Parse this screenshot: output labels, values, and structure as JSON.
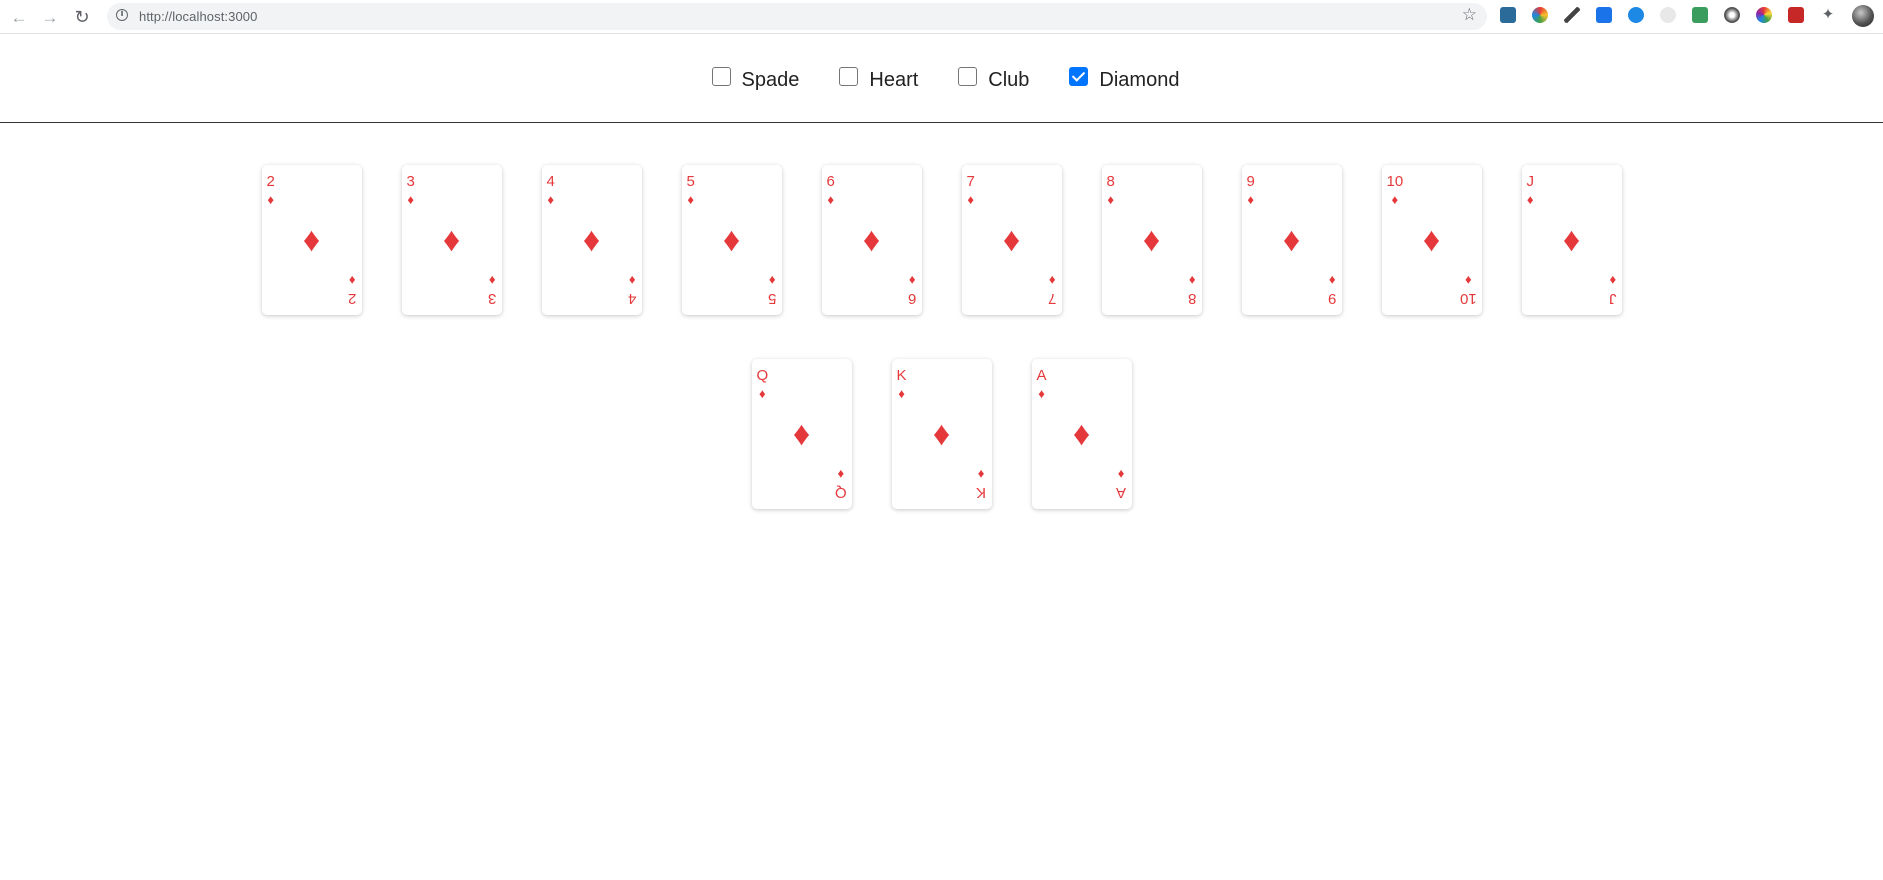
{
  "browser": {
    "url": "http://localhost:3000",
    "back_icon": "back-arrow-icon",
    "forward_icon": "forward-arrow-icon",
    "reload_icon": "reload-icon"
  },
  "filters": [
    {
      "label": "Spade",
      "checked": false
    },
    {
      "label": "Heart",
      "checked": false
    },
    {
      "label": "Club",
      "checked": false
    },
    {
      "label": "Diamond",
      "checked": true
    }
  ],
  "colors": {
    "card_red": "#e5383b",
    "checkbox_checked": "#0075ff"
  },
  "suit_symbol": "♦",
  "cards": [
    {
      "rank": "2",
      "suit": "diamond"
    },
    {
      "rank": "3",
      "suit": "diamond"
    },
    {
      "rank": "4",
      "suit": "diamond"
    },
    {
      "rank": "5",
      "suit": "diamond"
    },
    {
      "rank": "6",
      "suit": "diamond"
    },
    {
      "rank": "7",
      "suit": "diamond"
    },
    {
      "rank": "8",
      "suit": "diamond"
    },
    {
      "rank": "9",
      "suit": "diamond"
    },
    {
      "rank": "10",
      "suit": "diamond"
    },
    {
      "rank": "J",
      "suit": "diamond"
    },
    {
      "rank": "Q",
      "suit": "diamond"
    },
    {
      "rank": "K",
      "suit": "diamond"
    },
    {
      "rank": "A",
      "suit": "diamond"
    }
  ]
}
